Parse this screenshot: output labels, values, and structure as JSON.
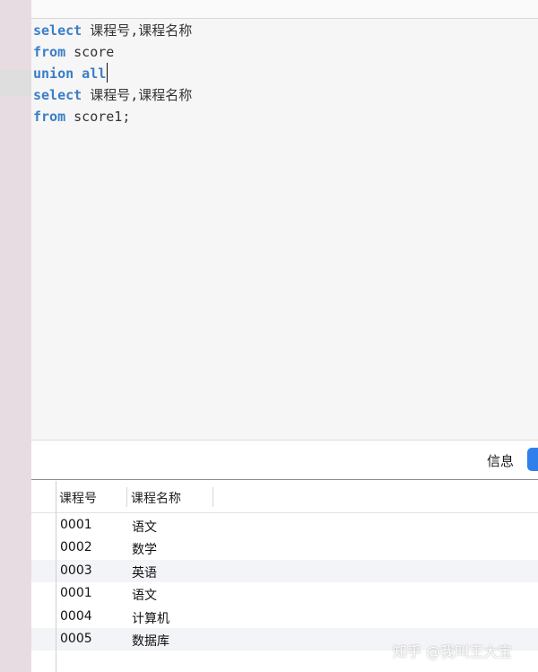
{
  "editor": {
    "lines": [
      {
        "keyword": "select",
        "rest": " 课程号,课程名称"
      },
      {
        "keyword": "from",
        "rest": " score"
      },
      {
        "keyword": "union all",
        "rest": ""
      },
      {
        "keyword": "select",
        "rest": " 课程号,课程名称"
      },
      {
        "keyword": "from",
        "rest": " score1;"
      }
    ]
  },
  "result_tabs": {
    "info_label": "信息"
  },
  "results": {
    "columns": [
      "课程号",
      "课程名称"
    ],
    "rows": [
      [
        "0001",
        "语文"
      ],
      [
        "0002",
        "数学"
      ],
      [
        "0003",
        "英语"
      ],
      [
        "0001",
        "语文"
      ],
      [
        "0004",
        "计算机"
      ],
      [
        "0005",
        "数据库"
      ]
    ]
  },
  "watermark": "知乎 @我叫王大宝",
  "colors": {
    "keyword": "#3a7ec8",
    "tab_accent": "#2f80ed",
    "left_strip": "#e8dce3"
  }
}
